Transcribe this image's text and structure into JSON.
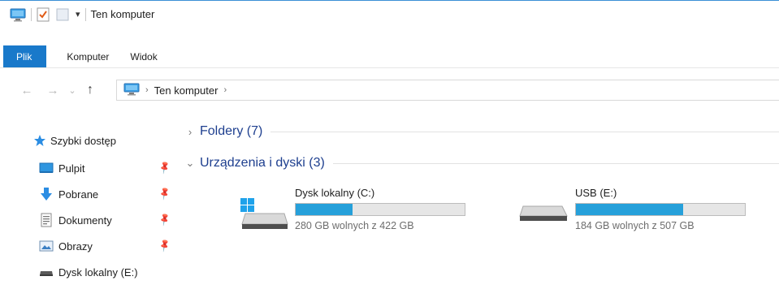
{
  "window": {
    "title": "Ten komputer"
  },
  "quick_access": {
    "icons": [
      "computer-icon",
      "properties-icon",
      "new-folder-icon",
      "customize-dropdown-icon"
    ]
  },
  "ribbon": {
    "tabs": [
      {
        "label": "Plik",
        "active": true
      },
      {
        "label": "Komputer"
      },
      {
        "label": "Widok"
      }
    ],
    "accent": "#1979ca"
  },
  "navigation": {
    "back_icon": "←",
    "forward_icon": "→",
    "recent_icon": "⌄",
    "up_icon": "↑",
    "breadcrumb": {
      "location": "Ten komputer"
    }
  },
  "sidebar": {
    "items": [
      {
        "label": "Szybki dostęp",
        "icon": "star-icon"
      },
      {
        "label": "Pulpit",
        "icon": "desktop-icon",
        "pinned": true
      },
      {
        "label": "Pobrane",
        "icon": "download-icon",
        "pinned": true
      },
      {
        "label": "Dokumenty",
        "icon": "document-icon",
        "pinned": true
      },
      {
        "label": "Obrazy",
        "icon": "pictures-icon",
        "pinned": true
      },
      {
        "label": "Dysk lokalny (E:)",
        "icon": "drive-icon"
      }
    ]
  },
  "content": {
    "groups": [
      {
        "title": "Foldery (7)",
        "expanded": false
      },
      {
        "title": "Urządzenia i dyski (3)",
        "expanded": true
      }
    ],
    "drives": [
      {
        "name": "Dysk lokalny (C:)",
        "info": "280 GB wolnych z 422 GB",
        "used_fraction": 0.337,
        "windows": true
      },
      {
        "name": "USB (E:)",
        "info": "184 GB wolnych z 507 GB",
        "used_fraction": 0.637,
        "windows": false
      }
    ],
    "bar_color": "#26a0da",
    "group_title_color": "#1e3f8f"
  }
}
